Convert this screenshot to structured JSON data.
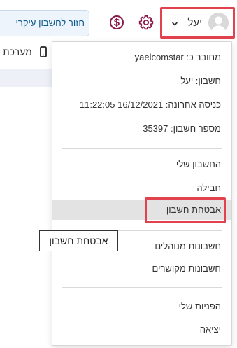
{
  "topbar": {
    "back_button_label": "חזור לחשבון עיקרי",
    "coin_icon": "dollar-coin-icon",
    "settings_icon": "gear-icon",
    "user": {
      "name": "יעל",
      "avatar_icon": "user-avatar-icon",
      "caret_icon": "chevron-down-icon"
    }
  },
  "background": {
    "system_label": "מערכת",
    "phone_icon": "phone-icon"
  },
  "menu": {
    "info": {
      "connected_as": "מחובר כ: yaelcomstar",
      "account": "חשבון: יעל",
      "last_login": "כניסה אחרונה: 16/12/2021 11:22:05",
      "account_number": "מספר חשבון: 35397"
    },
    "group1": {
      "my_account": "החשבון שלי",
      "package": "חבילה",
      "account_security": "אבטחת חשבון"
    },
    "group2": {
      "managed_accounts": "חשבונות מנוהלים",
      "linked_accounts": "חשבונות מקושרים"
    },
    "group3": {
      "my_tickets": "הפניות שלי",
      "logout": "יציאה"
    }
  },
  "tooltip": {
    "text": "אבטחת חשבון"
  },
  "colors": {
    "brand_text": "#0b5a8a",
    "icon_maroon": "#8b1a4a",
    "highlight_red": "#e2424e",
    "active_row": "#e3e3e3"
  }
}
